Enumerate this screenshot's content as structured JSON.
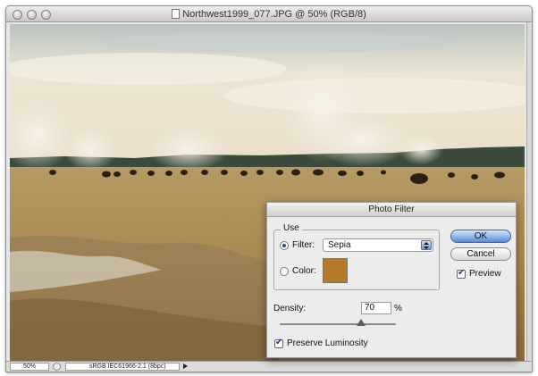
{
  "window": {
    "title": "Northwest1999_077.JPG @ 50% (RGB/8)"
  },
  "statusbar": {
    "zoom": "50%",
    "profile": "sRGB IEC61966-2.1 (8bpc)"
  },
  "dialog": {
    "title": "Photo Filter",
    "use_legend": "Use",
    "filter_label": "Filter:",
    "filter_value": "Sepia",
    "filter_selected": true,
    "color_label": "Color:",
    "color_swatch": "#b5792a",
    "density_label": "Density:",
    "density_value": "70",
    "density_unit": "%",
    "density_level": 0.7,
    "preserve_label": "Preserve Luminosity",
    "preserve_checked": true,
    "ok_label": "OK",
    "cancel_label": "Cancel",
    "preview_label": "Preview",
    "preview_checked": true
  }
}
